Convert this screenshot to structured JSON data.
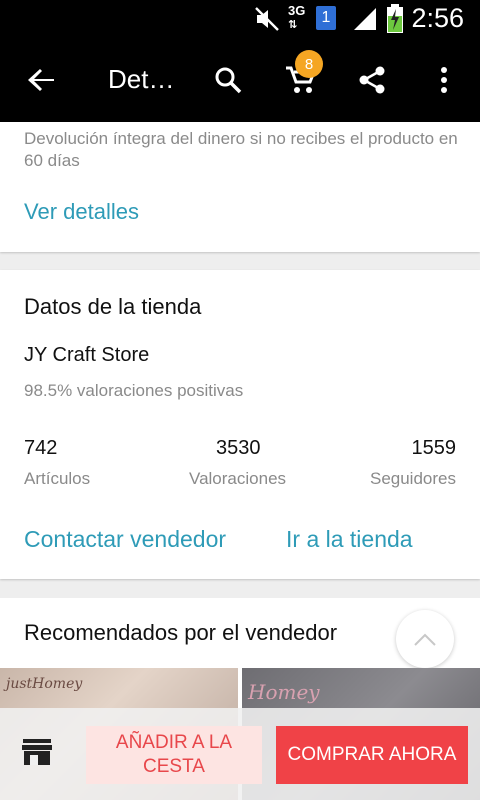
{
  "status_bar": {
    "network": "3G",
    "sim_badge": "1",
    "time": "2:56"
  },
  "toolbar": {
    "title": "Det…",
    "cart_count": "8"
  },
  "buyer_protection": {
    "text": "Devolución íntegra del dinero si no recibes el producto en 60 días",
    "details_link": "Ver detalles"
  },
  "store": {
    "section_title": "Datos de la tienda",
    "name": "JY Craft Store",
    "rating": "98.5% valoraciones positivas",
    "stats": [
      {
        "value": "742",
        "label": "Artículos"
      },
      {
        "value": "3530",
        "label": "Valoraciones"
      },
      {
        "value": "1559",
        "label": "Seguidores"
      }
    ],
    "contact_label": "Contactar vendedor",
    "visit_store_label": "Ir a la tienda"
  },
  "recommended": {
    "section_title": "Recomendados por el vendedor",
    "items": [
      {
        "watermark": "justHomey"
      },
      {
        "watermark": "Homey"
      }
    ]
  },
  "bottom_bar": {
    "add_to_cart": "AÑADIR A LA CESTA",
    "buy_now": "COMPRAR AHORA"
  },
  "colors": {
    "link": "#2e9bb7",
    "cart_badge": "#f5a623",
    "buy_button": "#f04247",
    "add_button_bg": "#fde4e2"
  }
}
